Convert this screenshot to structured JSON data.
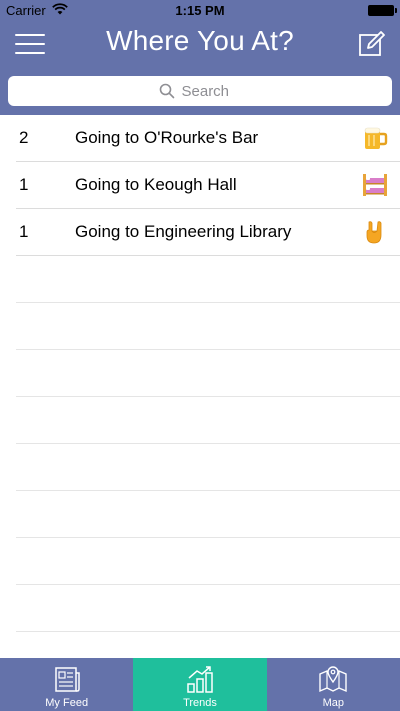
{
  "status_bar": {
    "carrier": "Carrier",
    "time": "1:15 PM"
  },
  "nav": {
    "title": "Where You At?",
    "menu_icon": "hamburger-menu-icon",
    "compose_icon": "compose-icon"
  },
  "search": {
    "placeholder": "Search",
    "icon": "search-icon"
  },
  "trends": [
    {
      "count": "2",
      "label": "Going to O'Rourke's Bar",
      "icon": "beer-mug-icon"
    },
    {
      "count": "1",
      "label": "Going to Keough Hall",
      "icon": "bunk-bed-icon"
    },
    {
      "count": "1",
      "label": "Going to Engineering Library",
      "icon": "rock-hand-icon"
    }
  ],
  "tabs": [
    {
      "label": "My Feed",
      "icon": "newspaper-icon",
      "active": false
    },
    {
      "label": "Trends",
      "icon": "bar-chart-icon",
      "active": true
    },
    {
      "label": "Map",
      "icon": "map-pin-icon",
      "active": false
    }
  ],
  "colors": {
    "nav": "#6472aa",
    "active_tab": "#1fbf9c",
    "divider": "#dcdcdc"
  }
}
